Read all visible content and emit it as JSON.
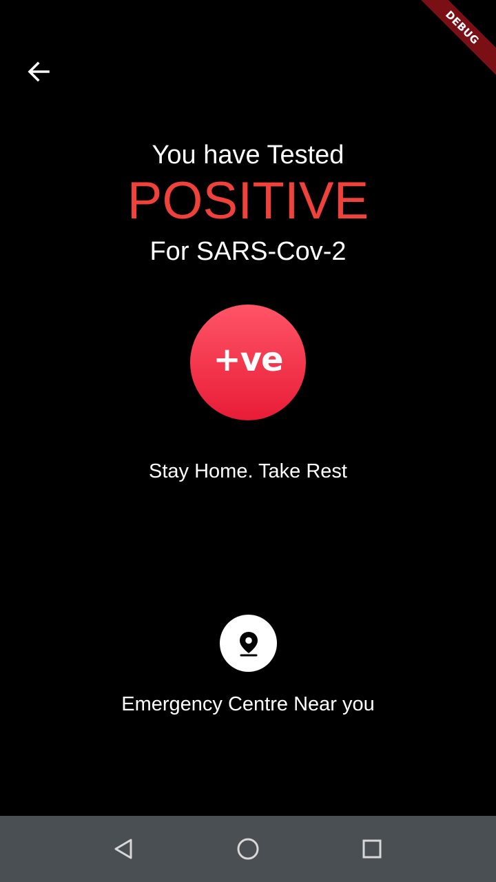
{
  "header": {
    "back_icon": "arrow-back-icon",
    "debug_banner": "DEBUG"
  },
  "result": {
    "line1": "You have Tested",
    "status": "POSITIVE",
    "line3": "For SARS-Cov-2",
    "badge_text": "+ve",
    "advice": "Stay Home. Take Rest"
  },
  "emergency": {
    "icon": "location-pin-icon",
    "label": "Emergency Centre Near you"
  },
  "navbar": {
    "items": [
      "back-nav-icon",
      "home-nav-icon",
      "recents-nav-icon"
    ]
  },
  "colors": {
    "background": "#000000",
    "positive_red": "#f0413b",
    "badge_gradient_top": "#ff5566",
    "badge_gradient_bottom": "#e81c37",
    "navbar": "#4a4f54",
    "debug_ribbon": "#7a1016"
  }
}
